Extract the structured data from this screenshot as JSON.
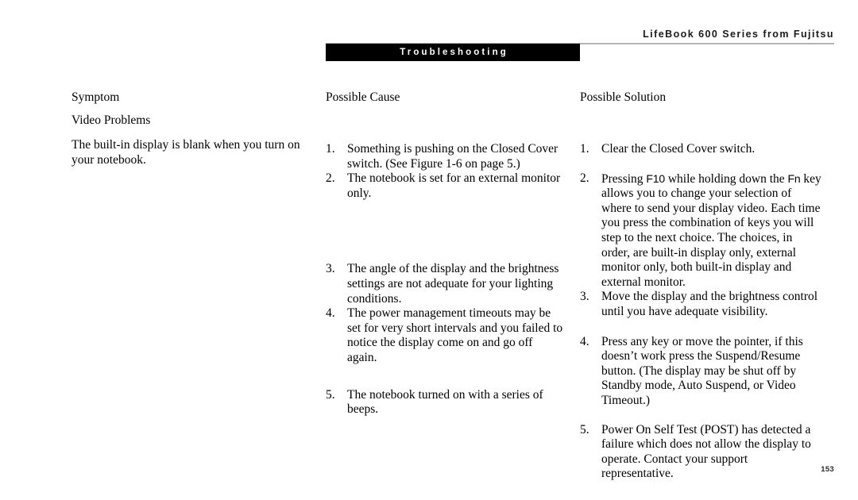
{
  "header": {
    "running_head": "LifeBook 600 Series from Fujitsu",
    "section_banner": "Troubleshooting",
    "rule_color": "#b4b4b4",
    "banner_bg": "#000000",
    "banner_text_color": "#ffffff"
  },
  "columns": {
    "symptom_heading": "Symptom",
    "cause_heading": "Possible Cause",
    "solution_heading": "Possible Solution"
  },
  "symptom": {
    "subhead": "Video Problems",
    "description": "The built-in display is blank when you turn on your notebook."
  },
  "possible_cause": {
    "items": [
      {
        "num": "1.",
        "text": "Something is pushing on the Closed Cover switch. (See Figure 1-6 on page 5.)"
      },
      {
        "num": "2.",
        "text": "The notebook is set for an external monitor only."
      },
      {
        "num": "3.",
        "text": "The angle of the display and the brightness settings are not adequate for your lighting conditions."
      },
      {
        "num": "4.",
        "text": "The power management timeouts may be set for very short intervals and you failed to notice the display come on and go off again."
      },
      {
        "num": "5.",
        "text": "The notebook turned on with a series of beeps."
      }
    ]
  },
  "possible_solution": {
    "items": [
      {
        "num": "1.",
        "text": "Clear the Closed Cover switch."
      },
      {
        "num": "2.",
        "text_before": "Pressing ",
        "key1": "F10",
        "text_middle": " while holding down the ",
        "key2": "Fn",
        "text_after": " key allows you to change your selection of where to send your display video. Each time you press the combination of keys you will step to the next choice. The choices, in order, are built-in display only, external monitor only, both built-in display and external monitor."
      },
      {
        "num": "3.",
        "text": "Move the display and the brightness control until you have adequate visibility."
      },
      {
        "num": "4.",
        "text": "Press any key or move the pointer, if this doesn’t work press the Suspend/Resume button. (The display may be shut off by Standby mode, Auto Suspend, or Video Timeout.)"
      },
      {
        "num": "5.",
        "text": "Power On Self Test (POST) has detected a failure which does not allow the display to operate. Contact your support representative."
      }
    ]
  },
  "folio": {
    "page_number": "153"
  }
}
